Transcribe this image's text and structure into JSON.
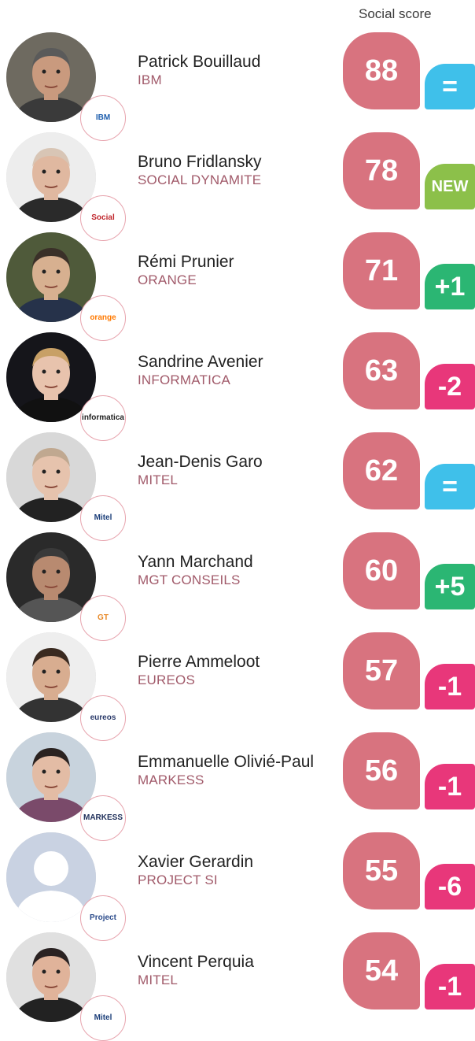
{
  "header": {
    "title": "Social score"
  },
  "colors": {
    "score": "#d8737f",
    "equal": "#3fc0ea",
    "new": "#8cc04a",
    "up": "#2bb673",
    "down": "#e8377a"
  },
  "rows": [
    {
      "name": "Patrick Bouillaud",
      "company": "IBM",
      "score": "88",
      "delta": "=",
      "delta_type": "equal",
      "logo": "IBM",
      "logo_color": "#1f5fae"
    },
    {
      "name": "Bruno Fridlansky",
      "company": "SOCIAL DYNAMITE",
      "score": "78",
      "delta": "NEW",
      "delta_type": "new",
      "logo": "Social",
      "logo_color": "#c0272d"
    },
    {
      "name": "Rémi Prunier",
      "company": "ORANGE",
      "score": "71",
      "delta": "+1",
      "delta_type": "up",
      "logo": "orange",
      "logo_color": "#ff7900"
    },
    {
      "name": "Sandrine Avenier",
      "company": "INFORMATICA",
      "score": "63",
      "delta": "-2",
      "delta_type": "down",
      "logo": "informatica",
      "logo_color": "#222222"
    },
    {
      "name": "Jean-Denis Garo",
      "company": "MITEL",
      "score": "62",
      "delta": "=",
      "delta_type": "equal",
      "logo": "Mitel",
      "logo_color": "#1c3f7a"
    },
    {
      "name": "Yann Marchand",
      "company": "MGT CONSEILS",
      "score": "60",
      "delta": "+5",
      "delta_type": "up",
      "logo": "GT",
      "logo_color": "#e88a2a"
    },
    {
      "name": "Pierre Ammeloot",
      "company": "EUREOS",
      "score": "57",
      "delta": "-1",
      "delta_type": "down",
      "logo": "eureos",
      "logo_color": "#2a3a6a"
    },
    {
      "name": "Emmanuelle Olivié-Paul",
      "company": "MARKESS",
      "score": "56",
      "delta": "-1",
      "delta_type": "down",
      "logo": "MARKESS",
      "logo_color": "#1f2f5a"
    },
    {
      "name": "Xavier Gerardin",
      "company": "PROJECT SI",
      "score": "55",
      "delta": "-6",
      "delta_type": "down",
      "logo": "Project",
      "logo_color": "#2a4a8a"
    },
    {
      "name": "Vincent Perquia",
      "company": "MITEL",
      "score": "54",
      "delta": "-1",
      "delta_type": "down",
      "logo": "Mitel",
      "logo_color": "#1c3f7a"
    }
  ]
}
